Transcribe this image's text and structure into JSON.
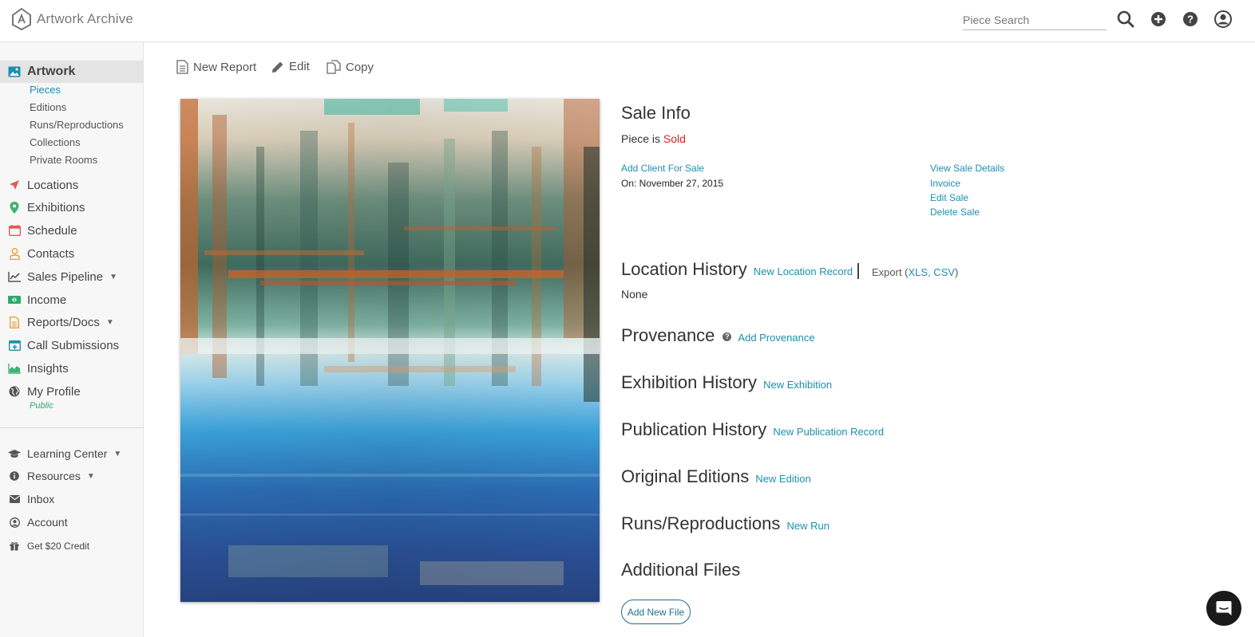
{
  "header": {
    "app_name": "Artwork Archive",
    "search_placeholder": "Piece Search",
    "icons": [
      "search-icon",
      "add-circle-icon",
      "help-icon",
      "user-account-icon"
    ]
  },
  "sidebar": {
    "artwork_label": "Artwork",
    "artwork_subitems": [
      "Pieces",
      "Editions",
      "Runs/Reproductions",
      "Collections",
      "Private Rooms"
    ],
    "items": [
      {
        "label": "Locations",
        "icon": "location-arrow-icon",
        "color": "#e05a5a"
      },
      {
        "label": "Exhibitions",
        "icon": "map-pin-icon",
        "color": "#3cb371"
      },
      {
        "label": "Schedule",
        "icon": "calendar-icon",
        "color": "#e05a5a"
      },
      {
        "label": "Contacts",
        "icon": "contact-icon",
        "color": "#e8a23a"
      },
      {
        "label": "Sales Pipeline",
        "icon": "chart-line-icon",
        "color": "#555555"
      },
      {
        "label": "Income",
        "icon": "money-icon",
        "color": "#2fa86b"
      },
      {
        "label": "Reports/Docs",
        "icon": "document-icon",
        "color": "#e8a23a"
      },
      {
        "label": "Call Submissions",
        "icon": "calendar-plus-icon",
        "color": "#1d8fb0"
      },
      {
        "label": "Insights",
        "icon": "area-chart-icon",
        "color": "#3cb371"
      },
      {
        "label": "My Profile",
        "icon": "globe-icon",
        "color": "#555555"
      }
    ],
    "profile_status": "Public",
    "secondary": [
      {
        "label": "Learning Center",
        "icon": "graduation-cap-icon"
      },
      {
        "label": "Resources",
        "icon": "info-icon"
      },
      {
        "label": "Inbox",
        "icon": "envelope-icon"
      },
      {
        "label": "Account",
        "icon": "account-circle-icon"
      },
      {
        "label": "Get $20 Credit",
        "icon": "gift-icon"
      }
    ]
  },
  "toolbar": {
    "new_report": "New Report",
    "edit": "Edit",
    "copy": "Copy"
  },
  "sale_info": {
    "title": "Sale Info",
    "status_prefix": "Piece is",
    "status": "Sold",
    "add_client": "Add Client For Sale",
    "date_line": "On: November 27, 2015",
    "actions": [
      "View Sale Details",
      "Invoice",
      "Edit Sale",
      "Delete Sale"
    ]
  },
  "sections": {
    "location_history": {
      "title": "Location History",
      "action": "New Location Record",
      "export_label": "Export (",
      "export_formats": "XLS, CSV",
      "export_close": ")",
      "empty": "None"
    },
    "provenance": {
      "title": "Provenance",
      "help": "?",
      "action": "Add Provenance"
    },
    "exhibition_history": {
      "title": "Exhibition History",
      "action": "New Exhibition"
    },
    "publication_history": {
      "title": "Publication History",
      "action": "New Publication Record"
    },
    "original_editions": {
      "title": "Original Editions",
      "action": "New Edition"
    },
    "runs_reproductions": {
      "title": "Runs/Reproductions",
      "action": "New Run"
    },
    "additional_files": {
      "title": "Additional Files",
      "action": "Add New File"
    }
  },
  "colors": {
    "link": "#1d8fb0",
    "sold": "#e02020",
    "accent_green": "#2fa86b"
  }
}
